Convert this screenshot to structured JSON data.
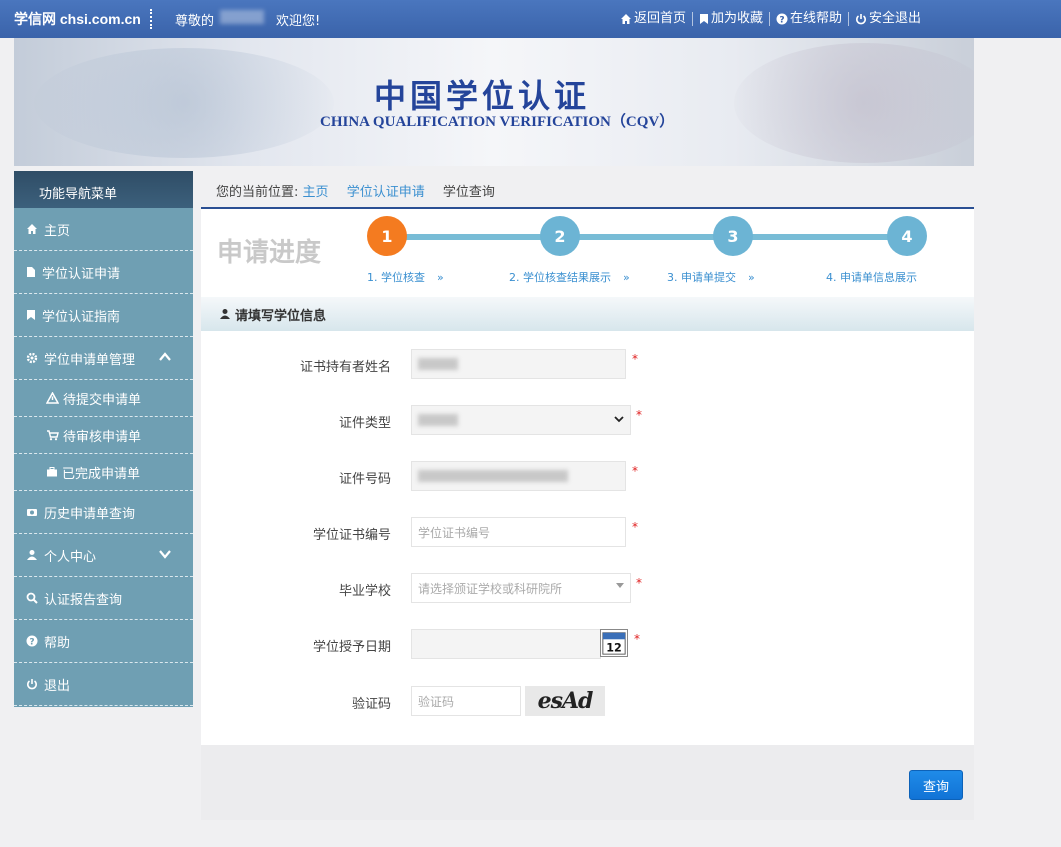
{
  "topbar": {
    "brand": "学信网 chsi.com.cn",
    "greeting": "尊敬的",
    "welcome": "欢迎您!",
    "links": [
      {
        "label": "返回首页",
        "icon": "home-icon"
      },
      {
        "label": "加为收藏",
        "icon": "bookmark-icon"
      },
      {
        "label": "在线帮助",
        "icon": "help-icon"
      },
      {
        "label": "安全退出",
        "icon": "power-icon"
      }
    ]
  },
  "banner": {
    "title": "中国学位认证",
    "subtitle": "CHINA QUALIFICATION VERIFICATION（CQV）"
  },
  "sidebar": {
    "header": "功能导航菜单",
    "items": [
      {
        "label": "主页",
        "icon": "home-icon"
      },
      {
        "label": "学位认证申请",
        "icon": "file-icon"
      },
      {
        "label": "学位认证指南",
        "icon": "bookmark-icon"
      },
      {
        "label": "学位申请单管理",
        "icon": "gear-icon"
      },
      {
        "label": "待提交申请单",
        "icon": "warning-icon"
      },
      {
        "label": "待审核申请单",
        "icon": "cart-icon"
      },
      {
        "label": "已完成申请单",
        "icon": "briefcase-icon"
      },
      {
        "label": "历史申请单查询",
        "icon": "camera-icon"
      },
      {
        "label": "个人中心",
        "icon": "user-icon"
      },
      {
        "label": "认证报告查询",
        "icon": "search-icon"
      },
      {
        "label": "帮助",
        "icon": "help-icon"
      },
      {
        "label": "退出",
        "icon": "power-icon"
      }
    ]
  },
  "breadcrumb": {
    "prefix": "您的当前位置:",
    "home": "主页",
    "apply": "学位认证申请",
    "current": "学位查询"
  },
  "progress": {
    "title": "申请进度",
    "steps": [
      {
        "number": "1",
        "label": "1. 学位核查"
      },
      {
        "number": "2",
        "label": "2. 学位核查结果展示"
      },
      {
        "number": "3",
        "label": "3. 申请单提交"
      },
      {
        "number": "4",
        "label": "4. 申请单信息展示"
      }
    ],
    "arrow": "»",
    "active_color": "#f47b20",
    "todo_color": "#6cb4d4"
  },
  "form": {
    "section_title": "请填写学位信息",
    "required_mark": "*",
    "fields": {
      "holder_name": {
        "label": "证书持有者姓名"
      },
      "id_type": {
        "label": "证件类型"
      },
      "id_number": {
        "label": "证件号码"
      },
      "cert_number": {
        "label": "学位证书编号",
        "placeholder": "学位证书编号"
      },
      "school": {
        "label": "毕业学校",
        "placeholder": "请选择颁证学校或科研院所"
      },
      "award_date": {
        "label": "学位授予日期",
        "calendar_day": "12"
      },
      "captcha": {
        "label": "验证码",
        "placeholder": "验证码",
        "image_text": "esAd"
      }
    },
    "submit_label": "查询"
  }
}
